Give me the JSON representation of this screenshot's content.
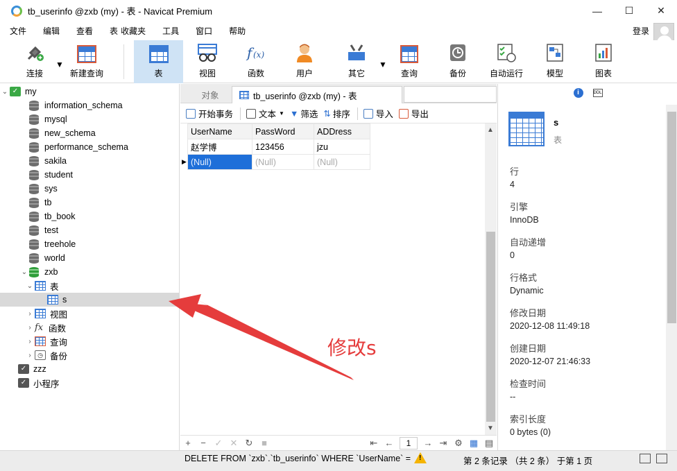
{
  "window": {
    "title": "tb_userinfo @zxb (my) - 表 - Navicat Premium",
    "minimize": "—",
    "maximize": "☐",
    "close": "✕"
  },
  "menu": [
    "文件",
    "编辑",
    "查看",
    "表",
    "收藏夹",
    "工具",
    "窗口",
    "帮助"
  ],
  "login": "登录",
  "toolbar": [
    {
      "label": "连接",
      "icon": "plug-icon"
    },
    {
      "label": "新建查询",
      "icon": "new-query-icon"
    },
    {
      "label": "表",
      "icon": "table-icon"
    },
    {
      "label": "视图",
      "icon": "view-icon"
    },
    {
      "label": "函数",
      "icon": "function-icon"
    },
    {
      "label": "用户",
      "icon": "user-icon"
    },
    {
      "label": "其它",
      "icon": "tools-icon"
    },
    {
      "label": "查询",
      "icon": "query-icon"
    },
    {
      "label": "备份",
      "icon": "backup-icon"
    },
    {
      "label": "自动运行",
      "icon": "schedule-icon"
    },
    {
      "label": "模型",
      "icon": "model-icon"
    },
    {
      "label": "图表",
      "icon": "chart-icon"
    }
  ],
  "tree": {
    "connection": "my",
    "databases": [
      "information_schema",
      "mysql",
      "new_schema",
      "performance_schema",
      "sakila",
      "student",
      "sys",
      "tb",
      "tb_book",
      "test",
      "treehole",
      "world"
    ],
    "open_db": "zxb",
    "tables_folder": "表",
    "table": "s",
    "folders": [
      "视图",
      "函数",
      "查询",
      "备份"
    ],
    "other_connections": [
      "zzz",
      "小程序"
    ]
  },
  "tabs": {
    "objects": "对象",
    "active": "tb_userinfo @zxb (my) - 表"
  },
  "subtoolbar": {
    "begin": "开始事务",
    "text": "文本",
    "filter": "筛选",
    "sort": "排序",
    "import": "导入",
    "export": "导出"
  },
  "grid": {
    "columns": [
      "UserName",
      "PassWord",
      "ADDress"
    ],
    "rows": [
      [
        "赵学博",
        "123456",
        "jzu"
      ]
    ],
    "new_row": [
      "(Null)",
      "(Null)",
      "(Null)"
    ]
  },
  "pager": {
    "page": "1"
  },
  "status": {
    "sql": "DELETE FROM `zxb`.`tb_userinfo` WHERE `UserName` =",
    "records": "第 2 条记录 （共 2 条） 于第 1 页"
  },
  "info": {
    "name": "s",
    "type": "表",
    "props": [
      {
        "label": "行",
        "value": "4"
      },
      {
        "label": "引擎",
        "value": "InnoDB"
      },
      {
        "label": "自动递增",
        "value": "0"
      },
      {
        "label": "行格式",
        "value": "Dynamic"
      },
      {
        "label": "修改日期",
        "value": "2020-12-08 11:49:18"
      },
      {
        "label": "创建日期",
        "value": "2020-12-07 21:46:33"
      },
      {
        "label": "检查时间",
        "value": "--"
      },
      {
        "label": "索引长度",
        "value": "0 bytes (0)"
      }
    ]
  },
  "annotation": "修改s",
  "colors": {
    "accent": "#1e6fd9",
    "annotation": "#e53c3c"
  }
}
